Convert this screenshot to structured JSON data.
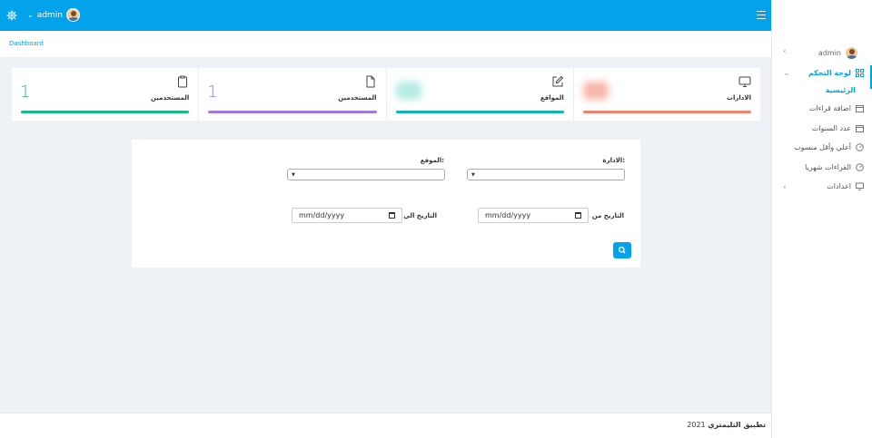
{
  "topbar": {
    "user_name": "admin",
    "settings_icon": "gear-icon",
    "menu_icon": "hamburger-icon"
  },
  "breadcrumb": {
    "label": "Dashboard"
  },
  "stats": [
    {
      "label": "الادارات",
      "icon": "monitor-icon",
      "color": "#f0846b",
      "value": "",
      "progress": 1.0
    },
    {
      "label": "المواقع",
      "icon": "edit-icon",
      "color": "#0fb5b5",
      "value": "",
      "progress": 1.0
    },
    {
      "label": "المستخدمين",
      "icon": "document-icon",
      "color": "#a378e0",
      "value": "1",
      "progress": 1.0
    },
    {
      "label": "المستخدمين",
      "icon": "clipboard-icon",
      "color": "#1cba8b",
      "value": "1",
      "progress": 1.0
    }
  ],
  "form": {
    "admin_label": "الادارة:",
    "site_label": "الموقع:",
    "date_from_label": "التاريخ من",
    "date_to_label": "التاريخ الي",
    "date_from_placeholder": "mm/dd/yyyy",
    "date_to_placeholder": "mm/dd/yyyy",
    "search_icon": "search-icon"
  },
  "sidebar": {
    "user_name": "admin",
    "items": [
      {
        "label": "لوحة التحكم",
        "icon": "grid-icon"
      },
      {
        "label": "اضافة قراءات",
        "icon": "calendar-icon"
      },
      {
        "label": "عدد السنوات",
        "icon": "calendar-icon"
      },
      {
        "label": "أعلي وأقل منسوب",
        "icon": "gauge-icon"
      },
      {
        "label": "القراءات شهريا",
        "icon": "gauge-icon"
      },
      {
        "label": "اعدادات",
        "icon": "monitor-icon"
      }
    ],
    "sub_active": "الرئيسية"
  },
  "footer": {
    "app_name": "تطبيق التليمتري",
    "year": "2021"
  },
  "colors": {
    "accent": "#03a3ec",
    "background": "#eef1f5"
  }
}
